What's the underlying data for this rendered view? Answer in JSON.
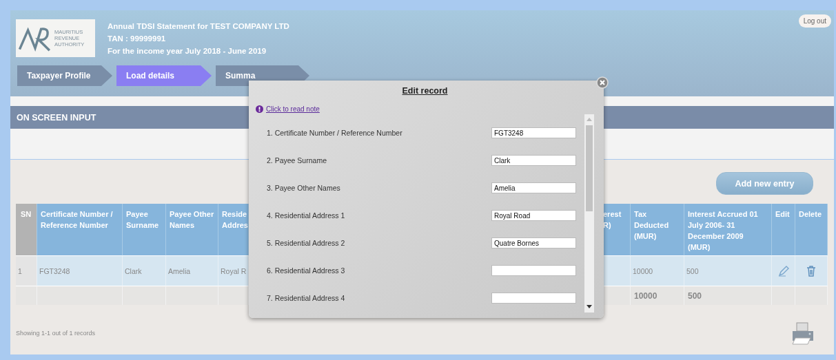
{
  "header": {
    "logo_lines": [
      "MAURITIUS",
      "REVENUE",
      "AUTHORITY"
    ],
    "title_lines": [
      "Annual TDSI Statement for TEST COMPANY LTD",
      "TAN : 99999991",
      "For the income year July 2018 - June 2019"
    ],
    "logout": "Log out"
  },
  "steps": [
    {
      "label": "Taxpayer Profile",
      "selected": false
    },
    {
      "label": "Load details",
      "selected": true
    },
    {
      "label": "Summa",
      "selected": false
    }
  ],
  "section_title": "ON SCREEN INPUT",
  "add_button": "Add new entry",
  "table": {
    "columns": [
      "SN",
      "Certificate Number / Reference Number",
      "Payee Surname",
      "Payee Other Names",
      "Reside Addres",
      "erest R)",
      "Tax Deducted (MUR)",
      "Interest Accrued 01 July 2006- 31 December 2009 (MUR)",
      "Edit",
      "Delete"
    ],
    "rows": [
      {
        "sn": "1",
        "certificate": "FGT3248",
        "surname": "Clark",
        "other_names": "Amelia",
        "address": "Royal R",
        "tax_deducted": "10000",
        "interest_accrued": "500"
      }
    ],
    "totals": {
      "tax_deducted": "10000",
      "interest_accrued": "500"
    }
  },
  "footer": "Showing 1-1 out of 1 records",
  "modal": {
    "title": "Edit record",
    "note_link": "Click to read note",
    "fields": [
      {
        "label": "1. Certificate Number / Reference Number",
        "value": "FGT3248"
      },
      {
        "label": "2. Payee Surname",
        "value": "Clark"
      },
      {
        "label": "3. Payee Other Names",
        "value": "Amelia"
      },
      {
        "label": "4. Residential Address 1",
        "value": "Royal Road"
      },
      {
        "label": "5. Residential Address 2",
        "value": "Quatre Bornes"
      },
      {
        "label": "6. Residential Address 3"
      },
      {
        "label": "7. Residential Address 4"
      }
    ]
  }
}
